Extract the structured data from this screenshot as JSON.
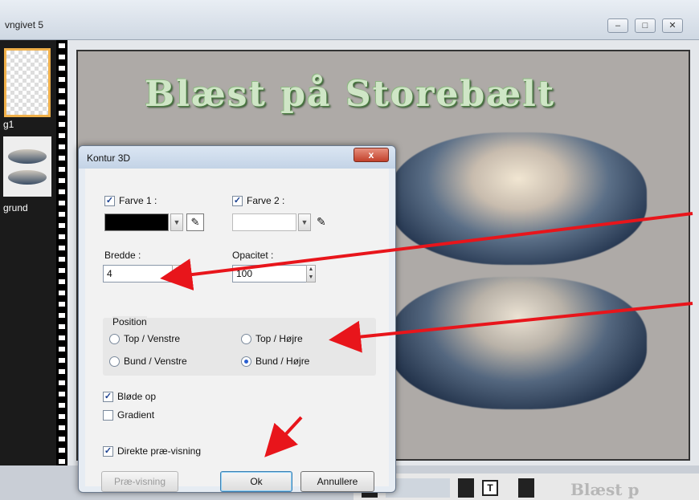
{
  "window": {
    "title": "vngivet 5",
    "min_icon": "minimize-icon",
    "max_icon": "maximize-icon",
    "close_icon": "close-icon"
  },
  "layers": {
    "layer1_label": "g1",
    "layer2_label": "grund"
  },
  "canvas": {
    "title": "Blæst på Storebælt"
  },
  "bottom": {
    "tool_t": "T",
    "preview_text": "Blæst p"
  },
  "dialog": {
    "title": "Kontur 3D",
    "close_label": "x",
    "farve1": {
      "label": "Farve 1 :",
      "checked": true,
      "color": "#000000"
    },
    "farve2": {
      "label": "Farve 2 :",
      "checked": true,
      "color": "#ffffff"
    },
    "bredde": {
      "label": "Bredde :",
      "value": "4"
    },
    "opacitet": {
      "label": "Opacitet :",
      "value": "100"
    },
    "position": {
      "label": "Position",
      "options": [
        "Top / Venstre",
        "Top / Højre",
        "Bund / Venstre",
        "Bund / Højre"
      ],
      "selected": "Bund / Højre"
    },
    "bloede_op": {
      "label": "Bløde op",
      "checked": true
    },
    "gradient": {
      "label": "Gradient",
      "checked": false
    },
    "direkte": {
      "label": "Direkte præ-visning",
      "checked": true
    },
    "buttons": {
      "preview": "Præ-visning",
      "ok": "Ok",
      "cancel": "Annullere"
    }
  },
  "annotation_color": "#e8151b"
}
